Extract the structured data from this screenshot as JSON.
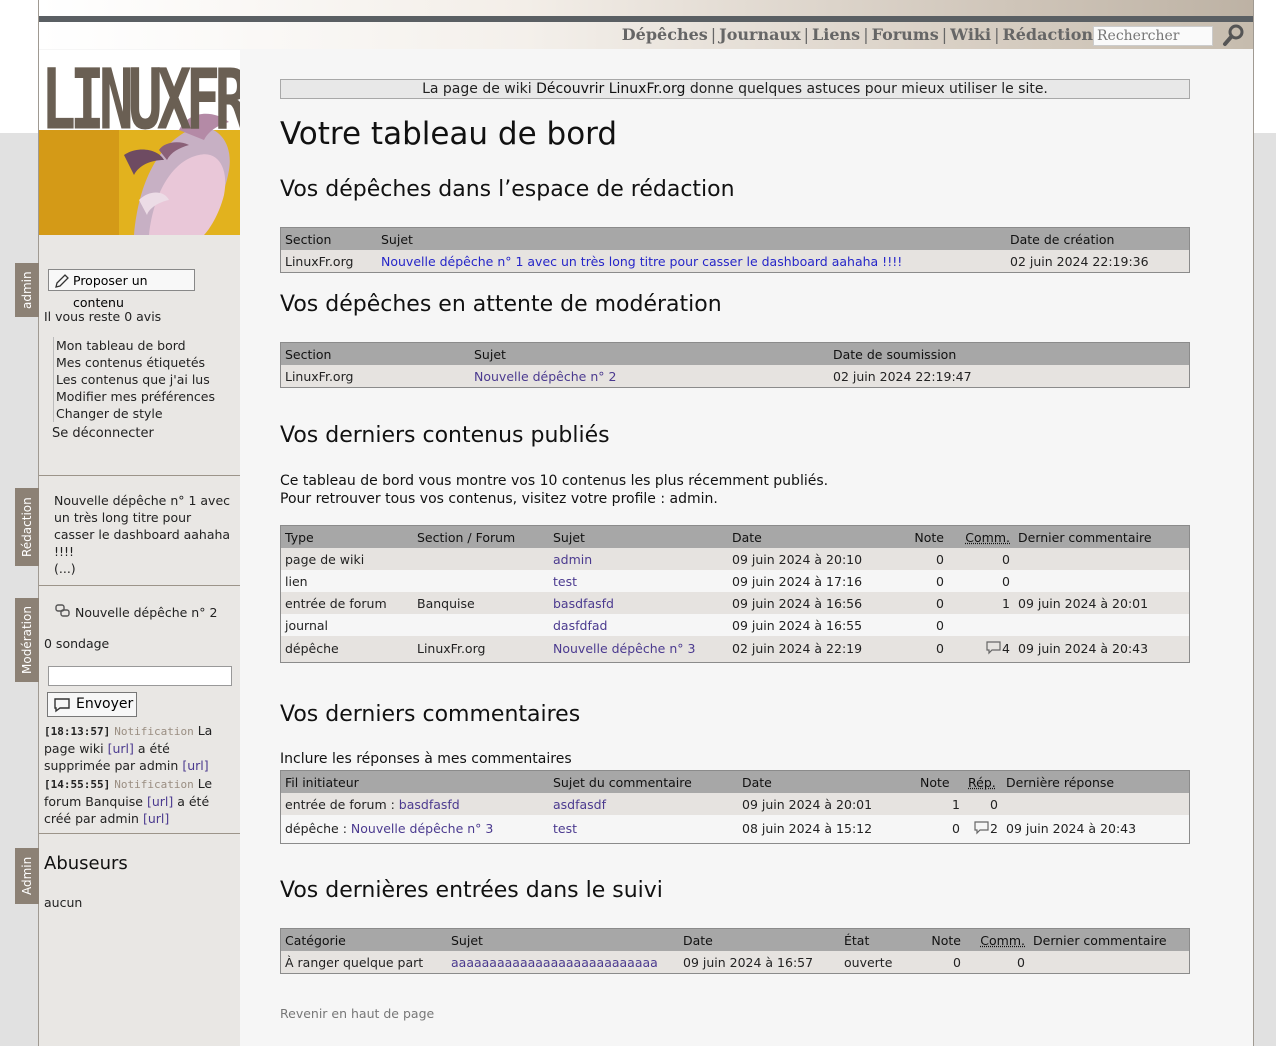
{
  "nav": {
    "links": [
      "Dépêches",
      "Journaux",
      "Liens",
      "Forums",
      "Wiki",
      "Rédaction"
    ],
    "search_placeholder": "Rechercher"
  },
  "logo": {
    "text": "LINUXFR.ORG"
  },
  "sidebar": {
    "admin_tab": "admin",
    "propose_button": "Proposer un contenu",
    "remaining_votes": "Il vous reste 0 avis",
    "menu": [
      "Mon tableau de bord",
      "Mes contenus étiquetés",
      "Les contenus que j'ai lus",
      "Modifier mes préférences",
      "Changer de style"
    ],
    "logout": "Se déconnecter",
    "redaction_tab": "Rédaction",
    "redaction_item": "Nouvelle dépêche n° 1 avec un très long titre pour casser le dashboard aahaha !!!!",
    "redaction_more": "(...)",
    "moderation_tab": "Modération",
    "moderation_item": "Nouvelle dépêche n° 2",
    "poll_count": "0 sondage",
    "send_button": "Envoyer",
    "notifications": [
      {
        "time": "[18:13:57]",
        "kind": "Notification",
        "text_a": "La page wiki",
        "link1": "[url]",
        "text_b": "a été supprimée par admin",
        "link2": "[url]"
      },
      {
        "time": "[14:55:55]",
        "kind": "Notification",
        "text_a": "Le forum Banquise",
        "link1": "[url]",
        "text_b": "a été créé par admin",
        "link2": "[url]"
      }
    ],
    "admin_tab2": "Admin",
    "abusers_title": "Abuseurs",
    "abusers_value": "aucun"
  },
  "main": {
    "banner_pre": "La page de wiki ",
    "banner_link": "Découvrir LinuxFr.org",
    "banner_post": " donne quelques astuces pour mieux utiliser le site.",
    "title": "Votre tableau de bord",
    "drafts": {
      "heading": "Vos dépêches dans l’espace de rédaction",
      "headers": [
        "Section",
        "Sujet",
        "Date de création"
      ],
      "rows": [
        [
          "LinuxFr.org",
          "Nouvelle dépêche n° 1 avec un très long titre pour casser le dashboard aahaha !!!!",
          "02 juin 2024 22:19:36"
        ]
      ]
    },
    "pending": {
      "heading": "Vos dépêches en attente de modération",
      "headers": [
        "Section",
        "Sujet",
        "Date de soumission"
      ],
      "rows": [
        [
          "LinuxFr.org",
          "Nouvelle dépêche n° 2",
          "02 juin 2024 22:19:47"
        ]
      ]
    },
    "published": {
      "heading": "Vos derniers contenus publiés",
      "intro1": "Ce tableau de bord vous montre vos 10 contenus les plus récemment publiés.",
      "intro2_pre": "Pour retrouver tous vos contenus, visitez votre profile : ",
      "intro2_link": "admin",
      "intro2_post": ".",
      "headers": [
        "Type",
        "Section / Forum",
        "Sujet",
        "Date",
        "Note",
        "Comm.",
        "Dernier commentaire"
      ],
      "rows": [
        [
          "page de wiki",
          "",
          "admin",
          "09 juin 2024 à 20:10",
          "0",
          "0",
          ""
        ],
        [
          "lien",
          "",
          "test",
          "09 juin 2024 à 17:16",
          "0",
          "0",
          ""
        ],
        [
          "entrée de forum",
          "Banquise",
          "basdfasfd",
          "09 juin 2024 à 16:56",
          "0",
          "1",
          "09 juin 2024 à 20:01"
        ],
        [
          "journal",
          "",
          "dasfdfad",
          "09 juin 2024 à 16:55",
          "0",
          "",
          ""
        ],
        [
          "dépêche",
          "LinuxFr.org",
          "Nouvelle dépêche n° 3",
          "02 juin 2024 à 22:19",
          "0",
          "4",
          "09 juin 2024 à 20:43"
        ]
      ]
    },
    "comments": {
      "heading": "Vos derniers commentaires",
      "toggle": "Inclure les réponses à mes commentaires",
      "headers": [
        "Fil initiateur",
        "Sujet du commentaire",
        "Date",
        "Note",
        "Rép.",
        "Dernière réponse"
      ],
      "rows": [
        [
          "entrée de forum : ",
          "basdfasfd",
          "asdfasdf",
          "09 juin 2024 à 20:01",
          "1",
          "0",
          ""
        ],
        [
          "dépêche : ",
          "Nouvelle dépêche n° 3",
          "test",
          "08 juin 2024 à 15:12",
          "0",
          "2",
          "09 juin 2024 à 20:43"
        ]
      ]
    },
    "tracker": {
      "heading": "Vos dernières entrées dans le suivi",
      "headers": [
        "Catégorie",
        "Sujet",
        "Date",
        "État",
        "Note",
        "Comm.",
        "Dernier commentaire"
      ],
      "rows": [
        [
          "À ranger quelque part",
          "aaaaaaaaaaaaaaaaaaaaaaaaaaa",
          "09 juin 2024 à 16:57",
          "ouverte",
          "0",
          "0",
          ""
        ]
      ]
    },
    "back_to_top": "Revenir en haut de page"
  }
}
